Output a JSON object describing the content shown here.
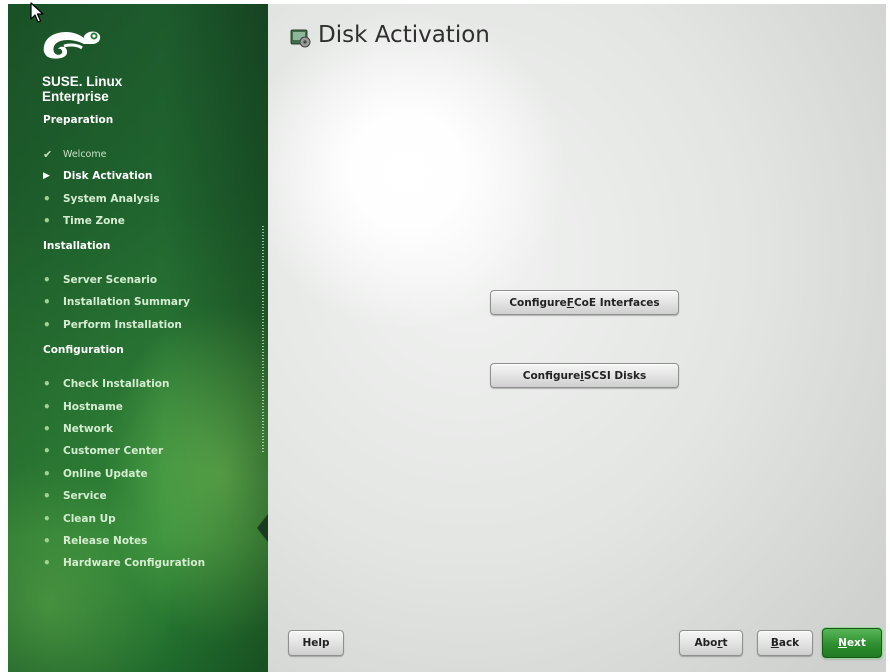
{
  "brand": {
    "line1": "SUSE. Linux",
    "line2": "Enterprise"
  },
  "sidebar": {
    "sections": [
      {
        "title": "Preparation",
        "steps": [
          {
            "label": "Welcome",
            "state": "done"
          },
          {
            "label": "Disk Activation",
            "state": "current"
          },
          {
            "label": "System Analysis",
            "state": "pending"
          },
          {
            "label": "Time Zone",
            "state": "pending"
          }
        ]
      },
      {
        "title": "Installation",
        "steps": [
          {
            "label": "Server Scenario",
            "state": "pending"
          },
          {
            "label": "Installation Summary",
            "state": "pending"
          },
          {
            "label": "Perform Installation",
            "state": "pending"
          }
        ]
      },
      {
        "title": "Configuration",
        "steps": [
          {
            "label": "Check Installation",
            "state": "pending"
          },
          {
            "label": "Hostname",
            "state": "pending"
          },
          {
            "label": "Network",
            "state": "pending"
          },
          {
            "label": "Customer Center",
            "state": "pending"
          },
          {
            "label": "Online Update",
            "state": "pending"
          },
          {
            "label": "Service",
            "state": "pending"
          },
          {
            "label": "Clean Up",
            "state": "pending"
          },
          {
            "label": "Release Notes",
            "state": "pending"
          },
          {
            "label": "Hardware Configuration",
            "state": "pending"
          }
        ]
      }
    ]
  },
  "main": {
    "title": "Disk Activation",
    "buttons": {
      "fcoe": {
        "before": "Configure ",
        "accel": "F",
        "after": "CoE Interfaces"
      },
      "iscsi": {
        "before": "Configure ",
        "accel": "i",
        "after": "SCSI Disks"
      }
    }
  },
  "footer": {
    "help": {
      "before": "Help",
      "accel": "",
      "after": ""
    },
    "abort": {
      "before": "Abo",
      "accel": "r",
      "after": "t"
    },
    "back": {
      "before": "",
      "accel": "B",
      "after": "ack"
    },
    "next": {
      "before": "",
      "accel": "N",
      "after": "ext"
    }
  },
  "icons": {
    "logo": "suse-chameleon-logo",
    "title": "disk-activation-icon",
    "done": "checkmark-icon",
    "current": "arrow-right-icon",
    "pending": "bullet-icon"
  },
  "colors": {
    "sidebar_green": "#20652f",
    "next_button": "#2f8f30"
  }
}
